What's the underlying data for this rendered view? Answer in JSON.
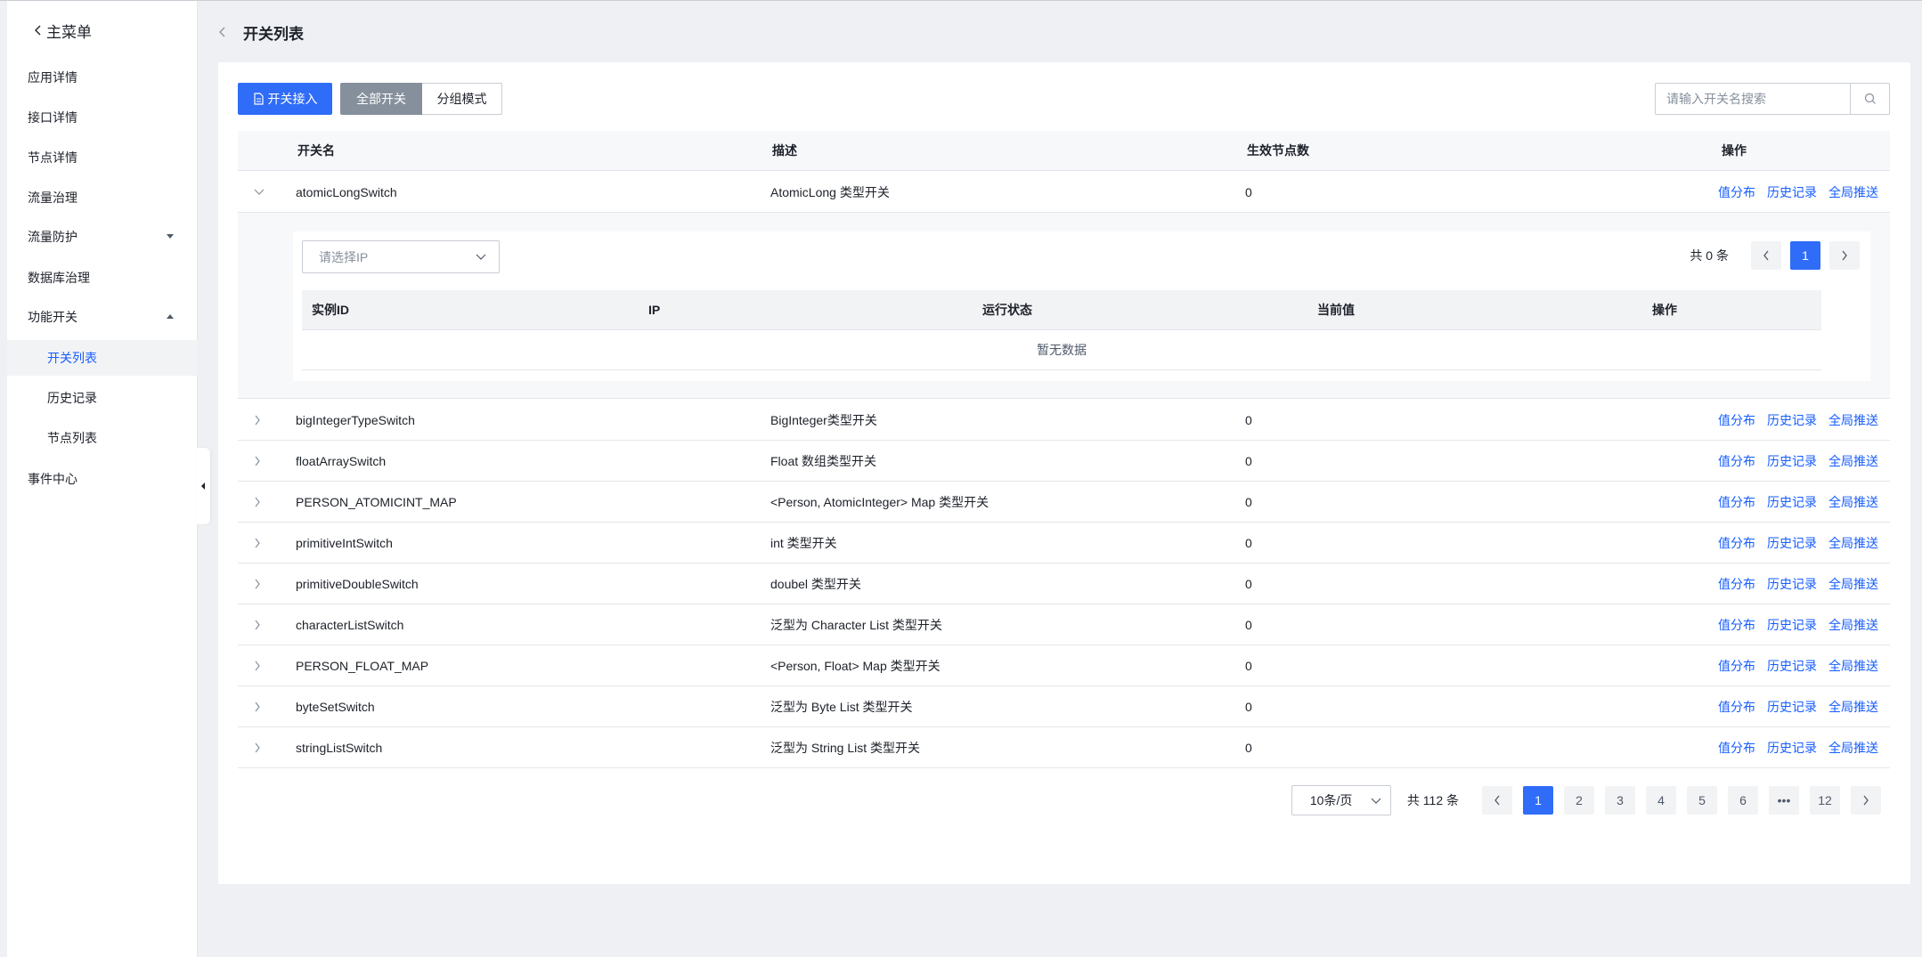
{
  "sidebar": {
    "back_label": "主菜单",
    "items": [
      {
        "label": "应用详情",
        "name": "sidebar-item-app-detail"
      },
      {
        "label": "接口详情",
        "name": "sidebar-item-api-detail"
      },
      {
        "label": "节点详情",
        "name": "sidebar-item-node-detail"
      },
      {
        "label": "流量治理",
        "name": "sidebar-item-traffic-governance"
      },
      {
        "label": "流量防护",
        "name": "sidebar-item-traffic-protection"
      },
      {
        "label": "数据库治理",
        "name": "sidebar-item-db-governance"
      },
      {
        "label": "功能开关",
        "name": "sidebar-item-feature-switch"
      },
      {
        "label": "开关列表",
        "name": "sidebar-item-switch-list"
      },
      {
        "label": "历史记录",
        "name": "sidebar-item-history"
      },
      {
        "label": "节点列表",
        "name": "sidebar-item-node-list"
      },
      {
        "label": "事件中心",
        "name": "sidebar-item-event-center"
      }
    ]
  },
  "header": {
    "title": "开关列表"
  },
  "toolbar": {
    "add_label": "开关接入",
    "all_label": "全部开关",
    "group_label": "分组模式",
    "search_placeholder": "请输入开关名搜索"
  },
  "table": {
    "columns": [
      "开关名",
      "描述",
      "生效节点数",
      "操作"
    ],
    "ops": [
      "值分布",
      "历史记录",
      "全局推送"
    ],
    "rows": [
      {
        "name": "atomicLongSwitch",
        "desc": "AtomicLong 类型开关",
        "nodes": "0"
      },
      {
        "name": "bigIntegerTypeSwitch",
        "desc": "BigInteger类型开关",
        "nodes": "0"
      },
      {
        "name": "floatArraySwitch",
        "desc": "Float 数组类型开关",
        "nodes": "0"
      },
      {
        "name": "PERSON_ATOMICINT_MAP",
        "desc": "<Person, AtomicInteger> Map 类型开关",
        "nodes": "0"
      },
      {
        "name": "primitiveIntSwitch",
        "desc": "int 类型开关",
        "nodes": "0"
      },
      {
        "name": "primitiveDoubleSwitch",
        "desc": "doubel 类型开关",
        "nodes": "0"
      },
      {
        "name": "characterListSwitch",
        "desc": "泛型为 Character List 类型开关",
        "nodes": "0"
      },
      {
        "name": "PERSON_FLOAT_MAP",
        "desc": "<Person, Float> Map 类型开关",
        "nodes": "0"
      },
      {
        "name": "byteSetSwitch",
        "desc": "泛型为 Byte List 类型开关",
        "nodes": "0"
      },
      {
        "name": "stringListSwitch",
        "desc": "泛型为 String List 类型开关",
        "nodes": "0"
      }
    ]
  },
  "expanded": {
    "ip_placeholder": "请选择IP",
    "total": "共 0 条",
    "page": "1",
    "columns": [
      "实例ID",
      "IP",
      "运行状态",
      "当前值",
      "操作"
    ],
    "empty": "暂无数据"
  },
  "pager": {
    "page_size": "10条/页",
    "total": "共 112 条",
    "pages": [
      "1",
      "2",
      "3",
      "4",
      "5",
      "6",
      "•••",
      "12"
    ],
    "current": "1"
  }
}
